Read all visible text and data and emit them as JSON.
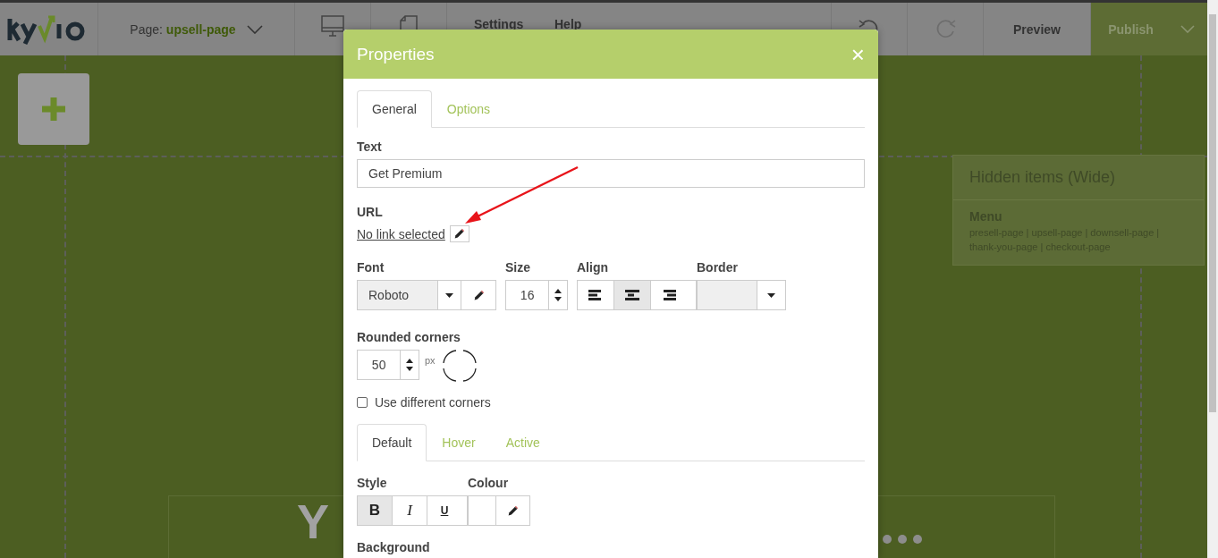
{
  "toolbar": {
    "page_label": "Page:",
    "page_name": "upsell-page",
    "menu_items": [
      "Settings",
      "Help"
    ],
    "preview": "Preview",
    "publish": "Publish"
  },
  "canvas": {
    "hidden_panel": {
      "title": "Hidden items (Wide)",
      "item_title": "Menu",
      "item_links": "presell-page | upsell-page | downsell-page | thank-you-page | checkout-page"
    },
    "headline": "Y"
  },
  "dialog": {
    "title": "Properties",
    "close": "×",
    "tabs": [
      {
        "label": "General",
        "selected": true
      },
      {
        "label": "Options",
        "selected": false
      }
    ],
    "text_field": {
      "label": "Text",
      "value": "Get Premium"
    },
    "url": {
      "label": "URL",
      "link": "No link selected"
    },
    "font": {
      "label": "Font",
      "value": "Roboto"
    },
    "size": {
      "label": "Size",
      "value": "16"
    },
    "align": {
      "label": "Align",
      "options": [
        {
          "kind": "left",
          "selected": false
        },
        {
          "kind": "center",
          "selected": true
        },
        {
          "kind": "right",
          "selected": false
        }
      ]
    },
    "border": {
      "label": "Border"
    },
    "rounded": {
      "label": "Rounded corners",
      "value": "50",
      "unit": "px"
    },
    "different_corners": {
      "label": "Use different corners",
      "checked": false
    },
    "state_tabs": [
      {
        "label": "Default",
        "selected": true
      },
      {
        "label": "Hover",
        "selected": false
      },
      {
        "label": "Active",
        "selected": false
      }
    ],
    "style": {
      "label": "Style",
      "options": [
        {
          "kind": "bold",
          "label": "B",
          "selected": true
        },
        {
          "kind": "italic",
          "label": "I",
          "selected": false
        },
        {
          "kind": "underline",
          "label": "U",
          "selected": false
        }
      ]
    },
    "colour": {
      "label": "Colour"
    },
    "background": {
      "label": "Background"
    }
  }
}
